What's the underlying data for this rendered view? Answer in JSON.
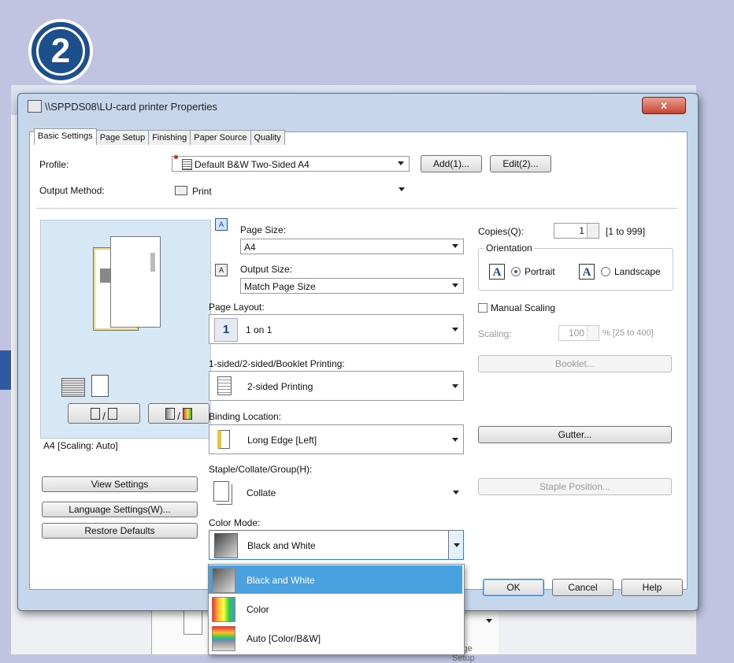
{
  "step_number": "2",
  "window": {
    "title": "\\\\SPPDS08\\LU-card printer Properties",
    "close_label": "x"
  },
  "background": {
    "page_setup_label": "Page Setup"
  },
  "tabs": [
    "Basic Settings",
    "Page Setup",
    "Finishing",
    "Paper Source",
    "Quality"
  ],
  "profile": {
    "label": "Profile:",
    "value": "Default B&W Two-Sided A4",
    "add_button": "Add(1)...",
    "edit_button": "Edit(2)..."
  },
  "output_method": {
    "label": "Output Method:",
    "value": "Print"
  },
  "preview": {
    "caption": "A4 [Scaling: Auto]"
  },
  "left_buttons": {
    "view_settings": "View Settings",
    "language_settings": "Language Settings(W)...",
    "restore_defaults": "Restore Defaults"
  },
  "page_size": {
    "label": "Page Size:",
    "value": "A4"
  },
  "output_size": {
    "label": "Output Size:",
    "value": "Match Page Size"
  },
  "page_layout": {
    "label": "Page Layout:",
    "icon_text": "1",
    "value": "1 on 1"
  },
  "sided": {
    "label": "1-sided/2-sided/Booklet Printing:",
    "value": "2-sided Printing"
  },
  "binding": {
    "label": "Binding Location:",
    "value": "Long Edge [Left]"
  },
  "staple": {
    "label": "Staple/Collate/Group(H):",
    "value": "Collate"
  },
  "color_mode": {
    "label": "Color Mode:",
    "value": "Black and White",
    "options": [
      "Black and White",
      "Color",
      "Auto [Color/B&W]"
    ]
  },
  "copies": {
    "label": "Copies(Q):",
    "value": "1",
    "range": "[1 to 999]"
  },
  "orientation": {
    "label": "Orientation",
    "portrait": "Portrait",
    "landscape": "Landscape",
    "icon_letter": "A",
    "selected": "Portrait"
  },
  "manual_scaling": {
    "label": "Manual Scaling",
    "checked": false
  },
  "scaling": {
    "label": "Scaling:",
    "value": "100",
    "range": "% [25 to 400]"
  },
  "buttons": {
    "booklet": "Booklet...",
    "gutter": "Gutter...",
    "staple_position": "Staple Position...",
    "ok": "OK",
    "cancel": "Cancel",
    "help": "Help"
  }
}
